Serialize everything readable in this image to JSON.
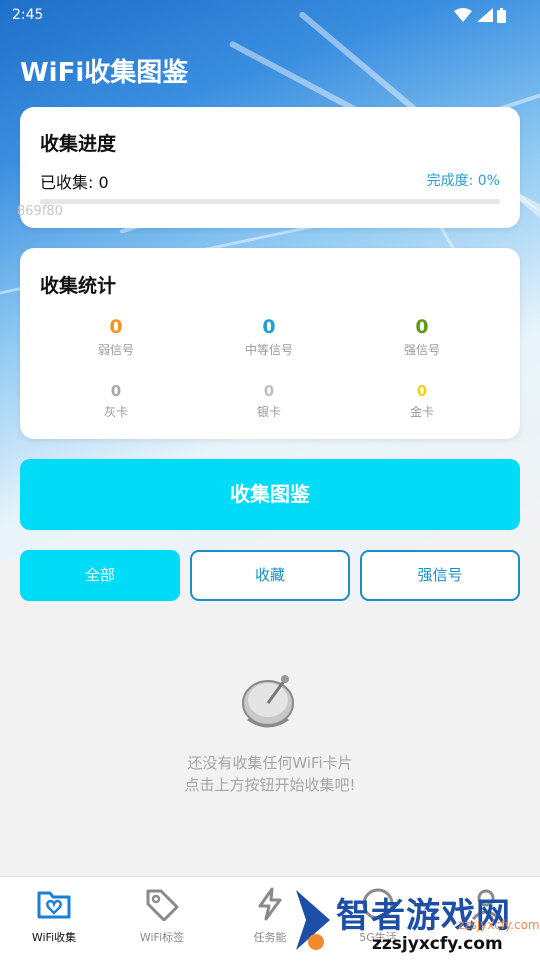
{
  "status_bar": {
    "time": "2:45"
  },
  "app_title": "WiFi收集图鉴",
  "progress_card": {
    "title": "收集进度",
    "collected_label": "已收集: 0",
    "completion_label": "完成度: 0%",
    "progress_fraction": 0,
    "overlay_code": "869f80"
  },
  "stats_card": {
    "title": "收集统计",
    "signal_stats": [
      {
        "value": "0",
        "label": "弱信号",
        "color": "#f5941e"
      },
      {
        "value": "0",
        "label": "中等信号",
        "color": "#1e9fd6"
      },
      {
        "value": "0",
        "label": "强信号",
        "color": "#5d9a16"
      }
    ],
    "card_stats": [
      {
        "value": "0",
        "label": "灰卡",
        "color": "#a8a8a8"
      },
      {
        "value": "0",
        "label": "银卡",
        "color": "#c0c0c0"
      },
      {
        "value": "0",
        "label": "金卡",
        "color": "#f0d21a"
      }
    ]
  },
  "collect_button": "收集图鉴",
  "filters": [
    {
      "label": "全部",
      "active": true
    },
    {
      "label": "收藏",
      "active": false
    },
    {
      "label": "强信号",
      "active": false
    }
  ],
  "empty_state": {
    "line1": "还没有收集任何WiFi卡片",
    "line2": "点击上方按钮开始收集吧!"
  },
  "tabs": [
    {
      "label": "WiFi收集",
      "icon": "folder-heart-icon",
      "active": true
    },
    {
      "label": "WiFi标签",
      "icon": "tag-icon",
      "active": false
    },
    {
      "label": "任务能",
      "icon": "lightning-icon",
      "active": false
    },
    {
      "label": "5G生活",
      "icon": "circle-icon",
      "active": false
    },
    {
      "label": "",
      "icon": "person-icon",
      "active": false
    }
  ],
  "watermark": {
    "brand": "智者游戏网",
    "url": "zzsjyxcfy.com",
    "url_small": "zzsjyxcfy.com"
  },
  "colors": {
    "accent": "#00dbf7",
    "outline": "#1a8fc7",
    "completion_text": "#2a9fd0"
  }
}
